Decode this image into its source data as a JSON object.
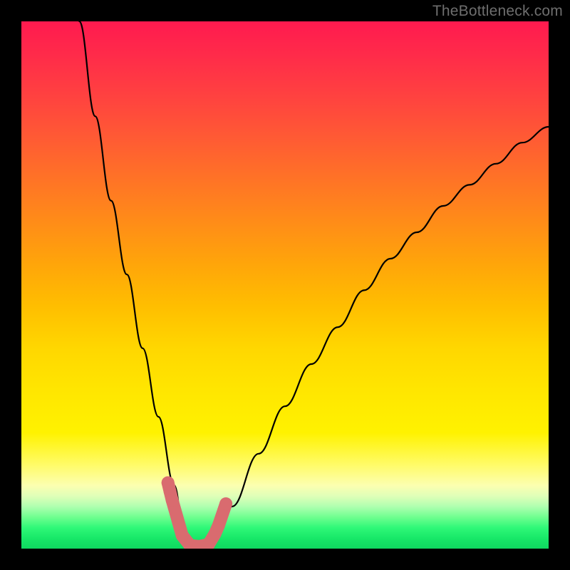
{
  "watermark": "TheBottleneck.com",
  "colors": {
    "frame": "#000000",
    "curve_stroke": "#000000",
    "marker_fill": "#d96b6f",
    "watermark_text": "#6e6e6e"
  },
  "chart_data": {
    "type": "line",
    "title": "",
    "xlabel": "",
    "ylabel": "",
    "xlim": [
      0,
      100
    ],
    "ylim": [
      0,
      100
    ],
    "grid": false,
    "legend": false,
    "note": "Axes are unlabeled in the image; values below are estimated from pixel positions on a 0–100 normalized scale. The curve is a V-shaped bottleneck plot with a flat minimum near x≈31–36 at y≈0 (green), rising steeply to the left and more gradually to the right.",
    "series": [
      {
        "name": "bottleneck-curve",
        "x": [
          11,
          14,
          17,
          20,
          23,
          26,
          29,
          31,
          33,
          35,
          37,
          40,
          45,
          50,
          55,
          60,
          65,
          70,
          75,
          80,
          85,
          90,
          95,
          100
        ],
        "y": [
          100,
          82,
          66,
          52,
          38,
          25,
          12,
          2,
          0,
          0,
          2,
          8,
          18,
          27,
          35,
          42,
          49,
          55,
          60,
          65,
          69,
          73,
          77,
          80
        ]
      }
    ],
    "markers": {
      "name": "highlight-dots",
      "x": [
        27.8,
        28.2,
        28.6,
        30.5,
        32.0,
        33.7,
        35.5,
        36.7,
        37.4,
        38.8
      ],
      "y": [
        12.5,
        10.8,
        9.2,
        2.5,
        0.6,
        0.4,
        0.8,
        2.8,
        4.4,
        8.5
      ]
    }
  }
}
